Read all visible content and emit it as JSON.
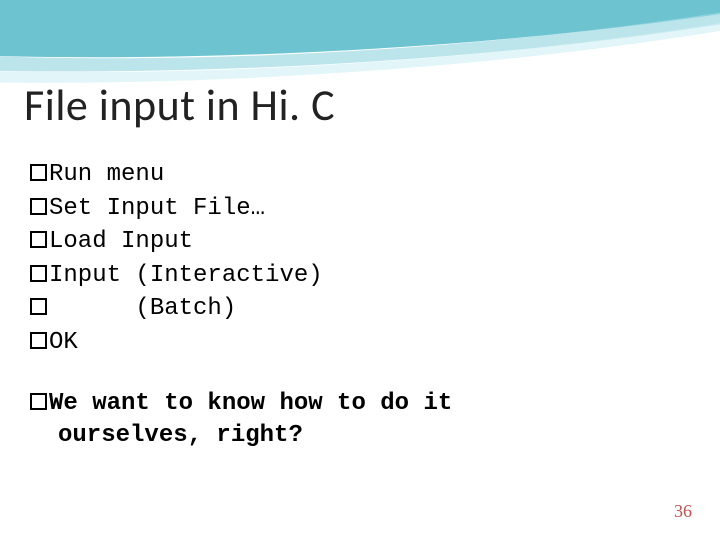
{
  "title": "File input in Hi. C",
  "items": [
    "Run menu",
    "Set Input File…",
    "Load Input",
    "Input (Interactive)",
    "      (Batch)",
    "OK"
  ],
  "emphasis_line1": "We want to know how to do it",
  "emphasis_line2": "ourselves, right?",
  "page_number": "36"
}
